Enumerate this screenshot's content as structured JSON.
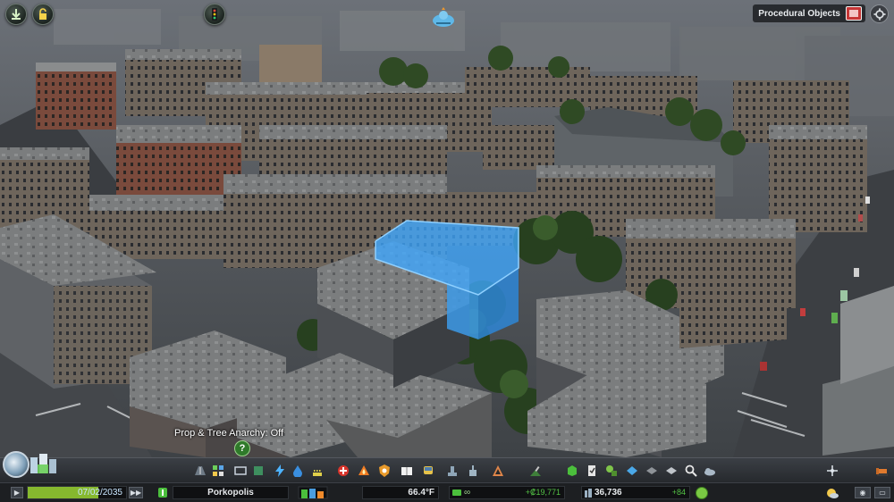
{
  "top_buttons": [
    {
      "name": "info-views",
      "icon": "info-views-icon"
    },
    {
      "name": "unlocking",
      "icon": "unlock-icon"
    },
    {
      "name": "traffic-routes",
      "icon": "traffic-light-icon"
    }
  ],
  "chirper": {
    "icon": "chirper-bird-icon"
  },
  "procedural_objects": {
    "label": "Procedural Objects",
    "icon": "procedural-objects-icon"
  },
  "settings": {
    "icon": "gear-icon"
  },
  "anarchy": {
    "label": "Prop & Tree Anarchy: Off",
    "help_symbol": "?"
  },
  "toolbar": {
    "tools": [
      "roads-icon",
      "zoning-icon",
      "districts-icon",
      "electricity-icon",
      "water-icon",
      "garbage-icon",
      "healthcare-icon",
      "fire-icon",
      "police-icon",
      "education-icon",
      "transport-icon",
      "parks-icon",
      "unique-buildings-icon",
      "monuments-icon",
      "wonders-icon",
      "landscaping-icon",
      "decoration-icon",
      "fountains-icon",
      "props-icon",
      "policies-icon",
      "find-it-icon",
      "weather-icon"
    ],
    "move_icon": "move-it-icon",
    "bulldozer_icon": "bulldozer-icon"
  },
  "infobar": {
    "date": "07/02/2035",
    "day_progress": 0.72,
    "city_name": "Porkopolis",
    "temperature": "66.4°F",
    "money_symbol": "∞",
    "income": "+₡19,771",
    "population": "36,736",
    "population_delta": "+84",
    "happiness_icon": "happy-face-icon"
  },
  "colors": {
    "selection": "#3fa8ff",
    "date_fill": "#9bd634",
    "positive": "#53c145"
  }
}
